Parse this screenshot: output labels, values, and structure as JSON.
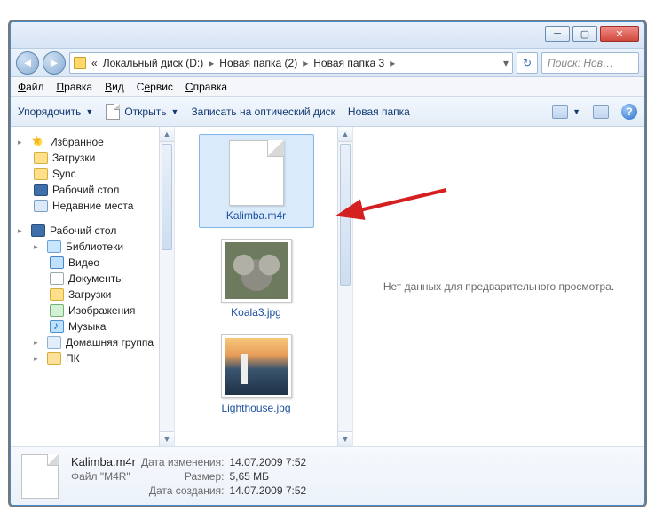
{
  "breadcrumb": {
    "prefix": "«",
    "parts": [
      "Локальный диск (D:)",
      "Новая папка (2)",
      "Новая папка 3"
    ]
  },
  "search": {
    "placeholder": "Поиск: Нов…"
  },
  "menu": {
    "file": "Файл",
    "edit": "Правка",
    "view": "Вид",
    "tools": "Сервис",
    "help": "Справка"
  },
  "toolbar": {
    "organize": "Упорядочить",
    "open": "Открыть",
    "burn": "Записать на оптический диск",
    "newfolder": "Новая папка"
  },
  "sidebar": {
    "favorites": "Избранное",
    "downloads": "Загрузки",
    "sync": "Sync",
    "desktop": "Рабочий стол",
    "recent": "Недавние места",
    "desktop2": "Рабочий стол",
    "libraries": "Библиотеки",
    "videos": "Видео",
    "documents": "Документы",
    "downloads2": "Загрузки",
    "pictures": "Изображения",
    "music": "Музыка",
    "homegroup": "Домашняя группа",
    "pc": "ПК"
  },
  "files": [
    {
      "name": "Kalimba.m4r",
      "type": "doc",
      "selected": true
    },
    {
      "name": "Koala3.jpg",
      "type": "koala",
      "selected": false
    },
    {
      "name": "Lighthouse.jpg",
      "type": "lighthouse",
      "selected": false
    }
  ],
  "preview": {
    "empty": "Нет данных для предварительного просмотра."
  },
  "details": {
    "name": "Kalimba.m4r",
    "type": "Файл \"M4R\"",
    "modified_k": "Дата изменения:",
    "modified_v": "14.07.2009 7:52",
    "size_k": "Размер:",
    "size_v": "5,65 МБ",
    "created_k": "Дата создания:",
    "created_v": "14.07.2009 7:52"
  }
}
